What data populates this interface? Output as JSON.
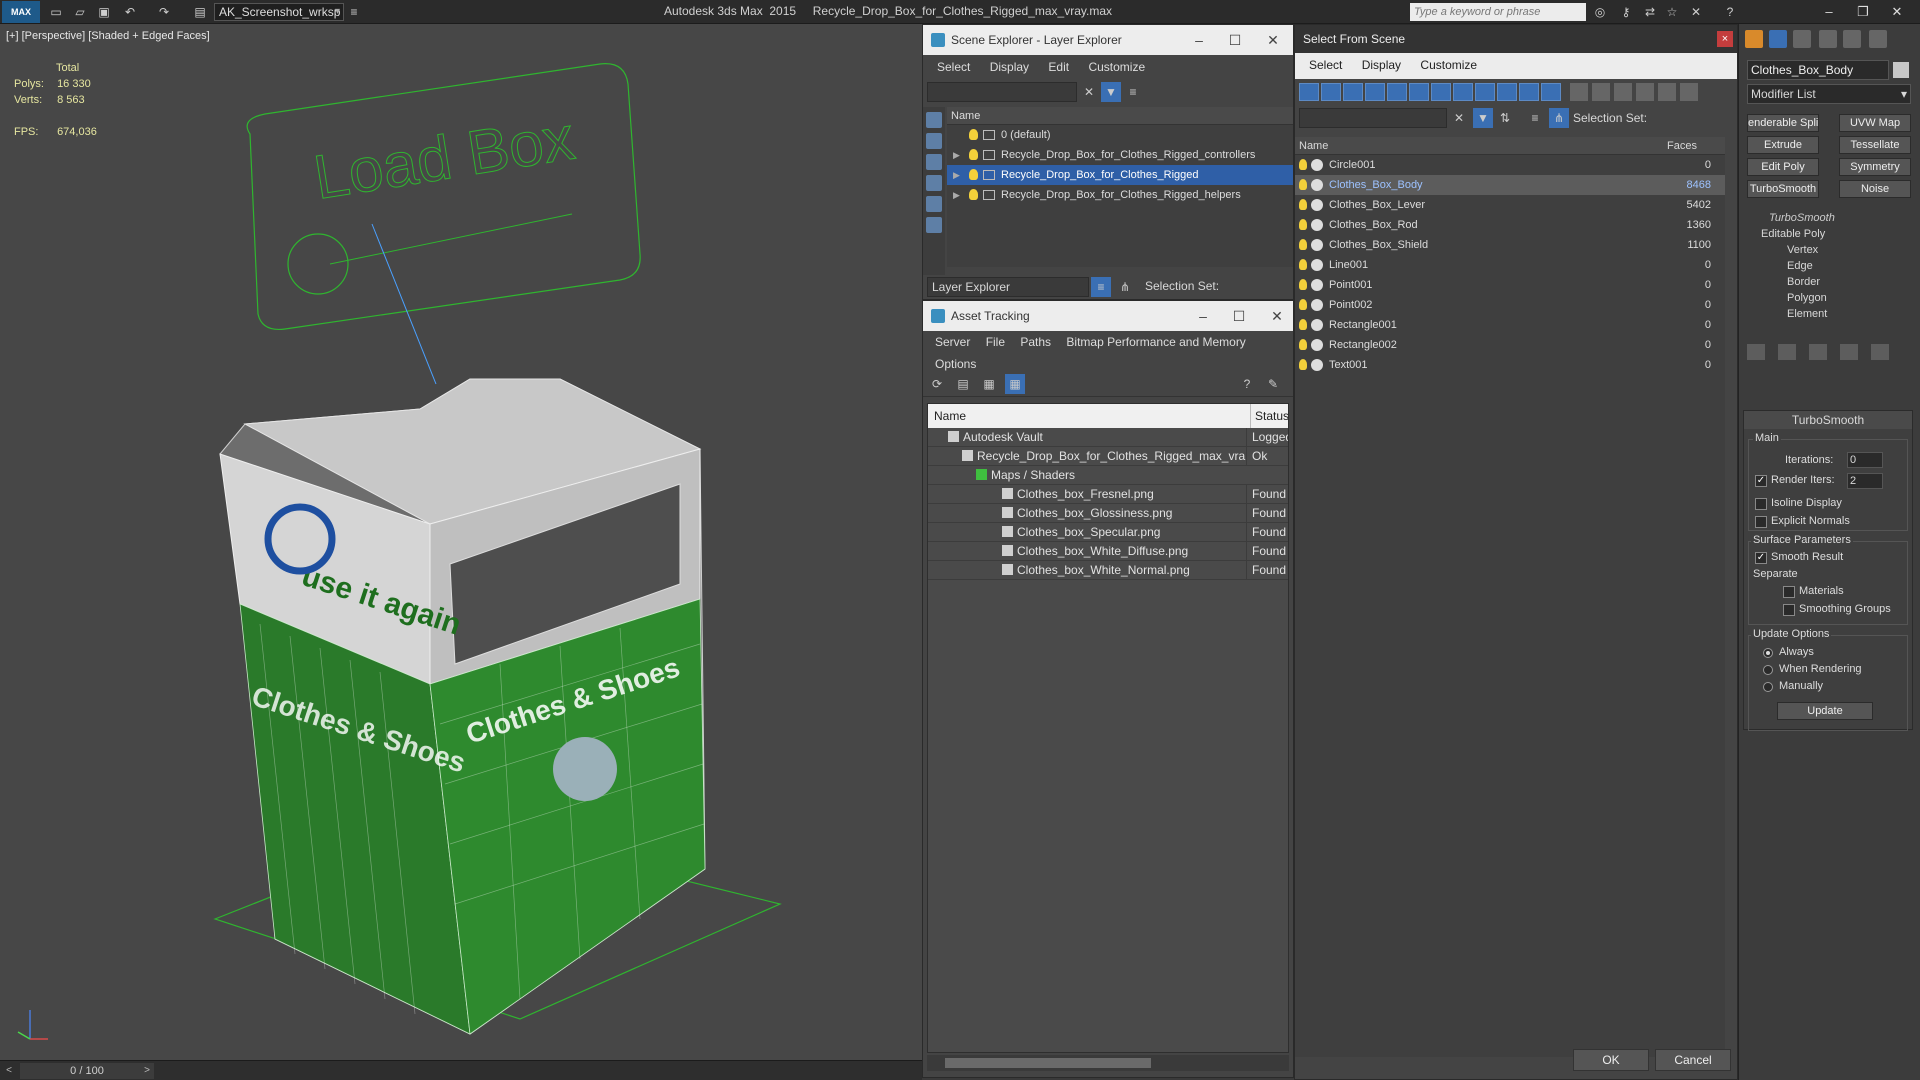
{
  "app": {
    "logo": "MAX",
    "workspace": "AK_Screenshot_wrksp",
    "title": "Autodesk 3ds Max  2015     Recycle_Drop_Box_for_Clothes_Rigged_max_vray.max",
    "search_placeholder": "Type a keyword or phrase"
  },
  "viewport": {
    "label": "[+] [Perspective] [Shaded + Edged Faces]",
    "stats": {
      "header": "Total",
      "polys_label": "Polys:",
      "polys": "16 330",
      "verts_label": "Verts:",
      "verts": "8 563",
      "fps_label": "FPS:",
      "fps": "674,036"
    },
    "scene_text": [
      "Load Box",
      "use it again",
      "Clothes & Shoes"
    ]
  },
  "timeline": {
    "frame": "0 / 100"
  },
  "scene_explorer": {
    "title": "Scene Explorer - Layer Explorer",
    "menu": [
      "Select",
      "Display",
      "Edit",
      "Customize"
    ],
    "column": "Name",
    "rows": [
      {
        "label": "0 (default)",
        "expand": ""
      },
      {
        "label": "Recycle_Drop_Box_for_Clothes_Rigged_controllers",
        "expand": "▶"
      },
      {
        "label": "Recycle_Drop_Box_for_Clothes_Rigged",
        "expand": "▶"
      },
      {
        "label": "Recycle_Drop_Box_for_Clothes_Rigged_helpers",
        "expand": "▶"
      }
    ],
    "footer_dropdown": "Layer Explorer",
    "selection_set_label": "Selection Set:"
  },
  "asset_tracking": {
    "title": "Asset Tracking",
    "menu1": [
      "Server",
      "File",
      "Paths",
      "Bitmap Performance and Memory"
    ],
    "menu2": [
      "Options"
    ],
    "col_name": "Name",
    "col_status": "Status",
    "rows": [
      {
        "name": "Autodesk Vault",
        "status": "Logged"
      },
      {
        "name": "Recycle_Drop_Box_for_Clothes_Rigged_max_vra...",
        "status": "Ok"
      },
      {
        "name": "Maps / Shaders",
        "status": ""
      },
      {
        "name": "Clothes_box_Fresnel.png",
        "status": "Found"
      },
      {
        "name": "Clothes_box_Glossiness.png",
        "status": "Found"
      },
      {
        "name": "Clothes_box_Specular.png",
        "status": "Found"
      },
      {
        "name": "Clothes_box_White_Diffuse.png",
        "status": "Found"
      },
      {
        "name": "Clothes_box_White_Normal.png",
        "status": "Found"
      }
    ]
  },
  "select_from_scene": {
    "title": "Select From Scene",
    "close": "×",
    "menu": [
      "Select",
      "Display",
      "Customize"
    ],
    "selection_set_label": "Selection Set:",
    "col_name": "Name",
    "col_faces": "Faces",
    "rows": [
      {
        "name": "Circle001",
        "faces": "0"
      },
      {
        "name": "Clothes_Box_Body",
        "faces": "8468"
      },
      {
        "name": "Clothes_Box_Lever",
        "faces": "5402"
      },
      {
        "name": "Clothes_Box_Rod",
        "faces": "1360"
      },
      {
        "name": "Clothes_Box_Shield",
        "faces": "1100"
      },
      {
        "name": "Line001",
        "faces": "0"
      },
      {
        "name": "Point001",
        "faces": "0"
      },
      {
        "name": "Point002",
        "faces": "0"
      },
      {
        "name": "Rectangle001",
        "faces": "0"
      },
      {
        "name": "Rectangle002",
        "faces": "0"
      },
      {
        "name": "Text001",
        "faces": "0"
      }
    ],
    "ok": "OK",
    "cancel": "Cancel"
  },
  "command_panel": {
    "object_name": "Clothes_Box_Body",
    "modifier_list": "Modifier List",
    "buttons": [
      "enderable Spli",
      "UVW Map",
      "Extrude",
      "Tessellate",
      "Edit Poly",
      "Symmetry",
      "TurboSmooth",
      "Noise"
    ],
    "stack": {
      "top": "TurboSmooth",
      "base": "Editable Poly",
      "subs": [
        "Vertex",
        "Edge",
        "Border",
        "Polygon",
        "Element"
      ]
    },
    "turbosmooth": {
      "title": "TurboSmooth",
      "main": "Main",
      "iterations_label": "Iterations:",
      "iterations": "0",
      "render_iters_label": "Render Iters:",
      "render_iters": "2",
      "isoline": "Isoline Display",
      "explicit": "Explicit Normals",
      "surface": "Surface Parameters",
      "smooth_result": "Smooth Result",
      "separate": "Separate",
      "materials": "Materials",
      "smoothing_groups": "Smoothing Groups",
      "update_options": "Update Options",
      "always": "Always",
      "when_rendering": "When Rendering",
      "manually": "Manually",
      "update": "Update"
    }
  }
}
